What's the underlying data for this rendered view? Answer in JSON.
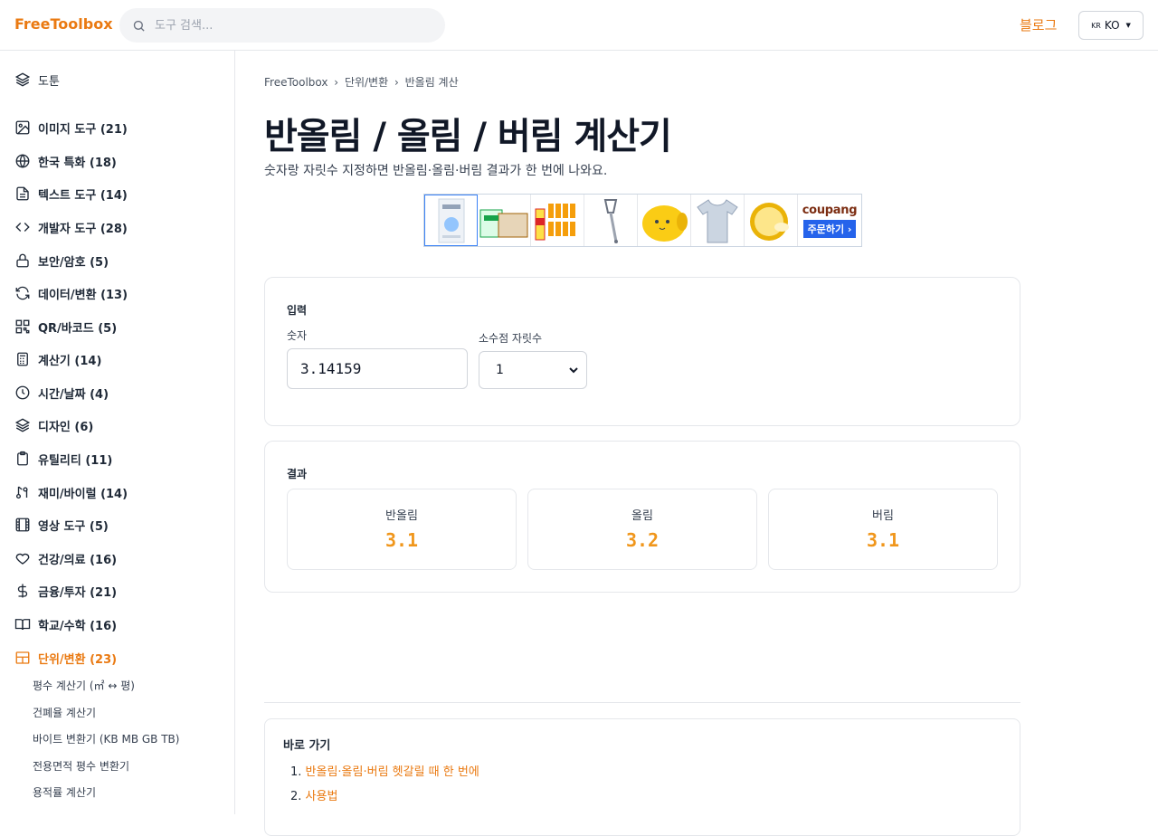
{
  "header": {
    "logo": "FreeToolbox",
    "search_placeholder": "도구 검색...",
    "blog_label": "블로그",
    "lang_flag": "KR",
    "lang_label": "KO"
  },
  "sidebar": {
    "top_item": "도툰",
    "categories": [
      {
        "label": "이미지 도구 (21)",
        "icon": "image-icon"
      },
      {
        "label": "한국 특화 (18)",
        "icon": "globe-icon"
      },
      {
        "label": "텍스트 도구 (14)",
        "icon": "document-icon"
      },
      {
        "label": "개발자 도구 (28)",
        "icon": "code-icon"
      },
      {
        "label": "보안/암호 (5)",
        "icon": "lock-icon"
      },
      {
        "label": "데이터/변환 (13)",
        "icon": "refresh-icon"
      },
      {
        "label": "QR/바코드 (5)",
        "icon": "qr-icon"
      },
      {
        "label": "계산기 (14)",
        "icon": "calculator-icon"
      },
      {
        "label": "시간/날짜 (4)",
        "icon": "clock-icon"
      },
      {
        "label": "디자인 (6)",
        "icon": "layers-icon"
      },
      {
        "label": "유틸리티 (11)",
        "icon": "clipboard-icon"
      },
      {
        "label": "재미/바이럴 (14)",
        "icon": "music-icon"
      },
      {
        "label": "영상 도구 (5)",
        "icon": "film-icon"
      },
      {
        "label": "건강/의료 (16)",
        "icon": "heart-icon"
      },
      {
        "label": "금융/투자 (21)",
        "icon": "dollar-icon"
      },
      {
        "label": "학교/수학 (16)",
        "icon": "book-icon"
      },
      {
        "label": "단위/변환 (23)",
        "icon": "grid-icon"
      }
    ],
    "sub_items": [
      "평수 계산기 (㎡ ↔ 평)",
      "건폐율 계산기",
      "바이트 변환기 (KB MB GB TB)",
      "전용면적 평수 변환기",
      "용적률 계산기"
    ]
  },
  "breadcrumb": [
    "FreeToolbox",
    "›",
    "단위/변환",
    "›",
    "반올림 계산"
  ],
  "page": {
    "title": "반올림 / 올림 / 버림 계산기",
    "subtitle": "숫자랑 자릿수 지정하면 반올림·올림·버림 결과가 한 번에 나와요."
  },
  "ad": {
    "brand": "coupang",
    "order_label": "주문하기 ›"
  },
  "input_card": {
    "title": "입력",
    "number_label": "숫자",
    "number_value": "3.14159",
    "decimals_label": "소수점 자릿수",
    "decimals_value": "1"
  },
  "result_card": {
    "title": "결과",
    "results": [
      {
        "label": "반올림",
        "value": "3.1"
      },
      {
        "label": "올림",
        "value": "3.2"
      },
      {
        "label": "버림",
        "value": "3.1"
      }
    ]
  },
  "toc": {
    "title": "바로 가기",
    "items": [
      {
        "num": "1.",
        "label": "반올림·올림·버림 헷갈릴 때 한 번에"
      },
      {
        "num": "2.",
        "label": "사용법"
      }
    ]
  },
  "colors": {
    "accent": "#ea7a12",
    "result_value": "#f0961b",
    "border": "#e5e7eb"
  }
}
